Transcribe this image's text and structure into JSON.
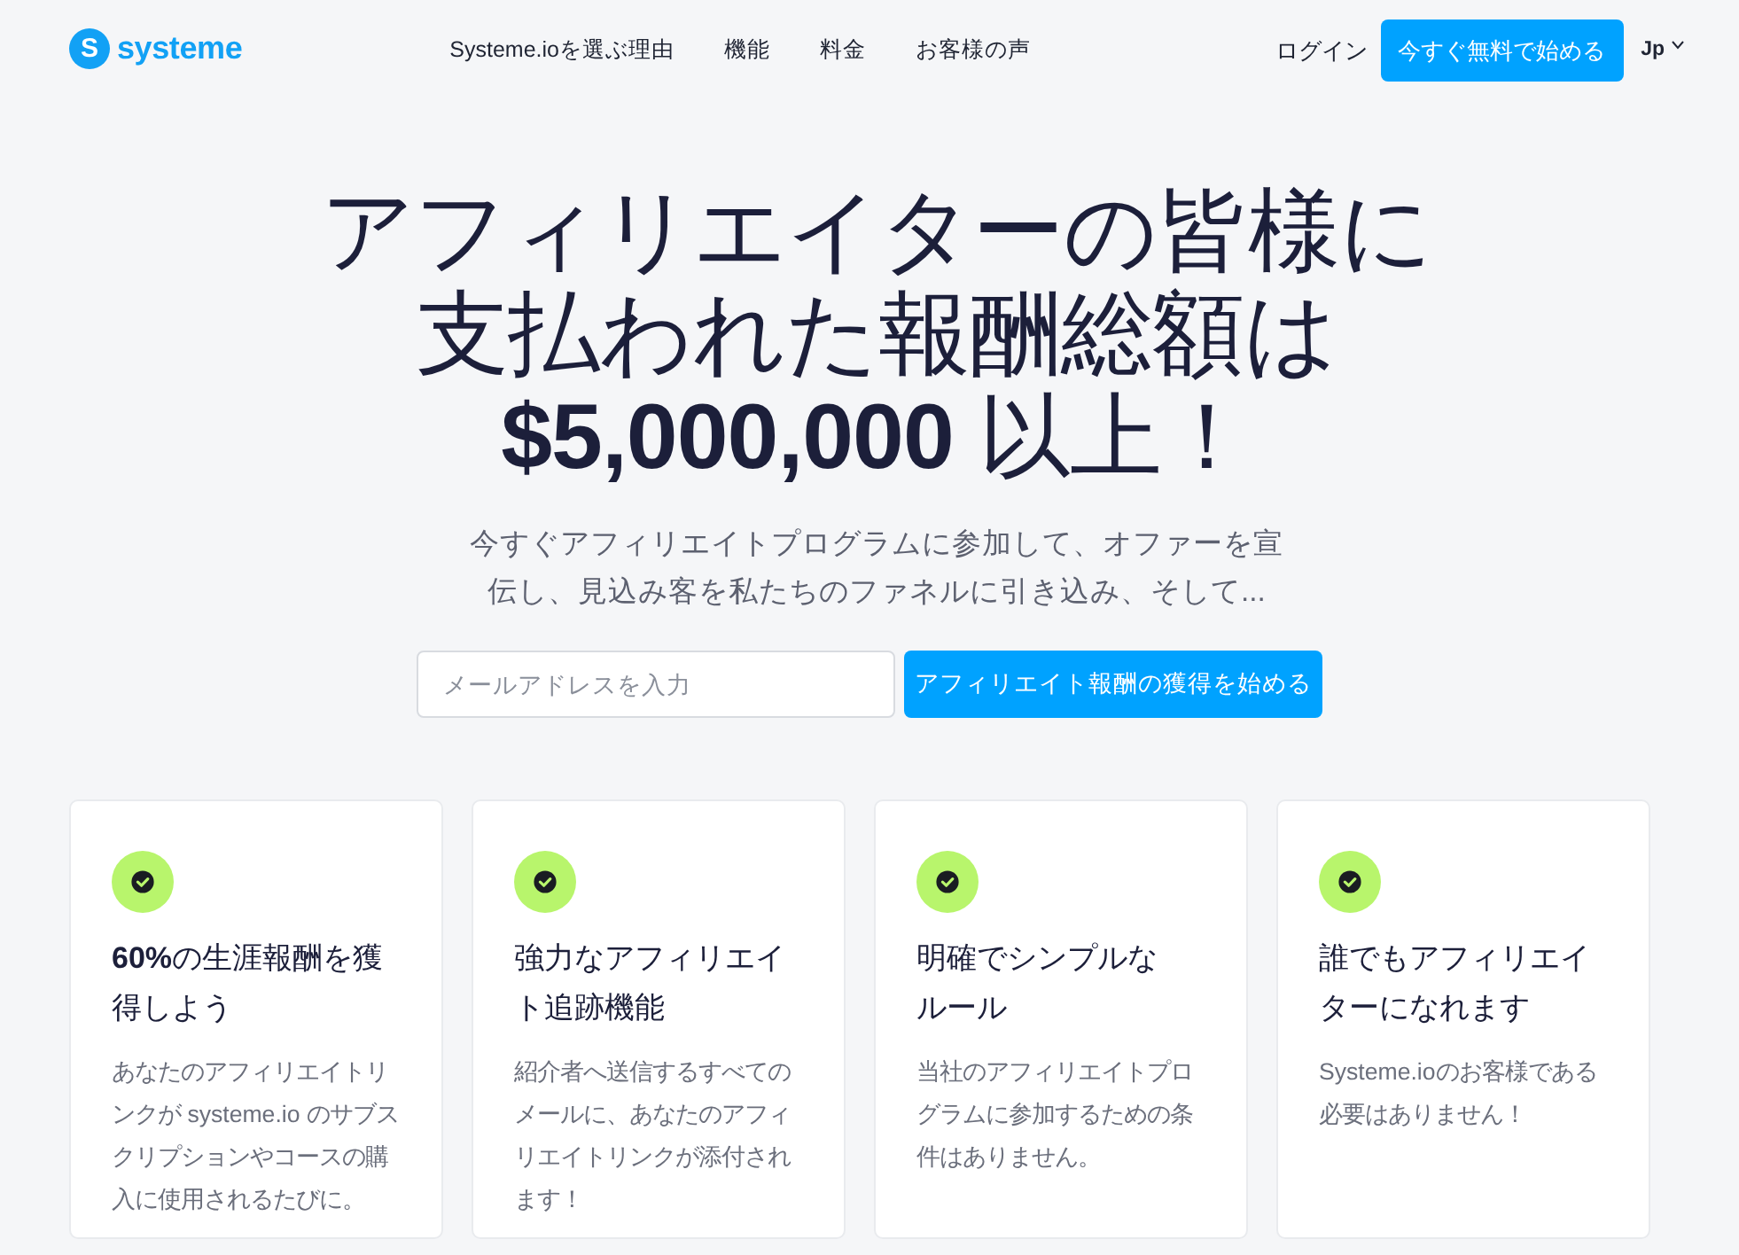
{
  "nav": {
    "logo": {
      "letter": "S",
      "text": "systeme"
    },
    "links": [
      {
        "label": "Systeme.ioを選ぶ理由"
      },
      {
        "label": "機能"
      },
      {
        "label": "料金"
      },
      {
        "label": "お客様の声"
      }
    ],
    "login": "ログイン",
    "cta": "今すぐ無料で始める",
    "language": "Jp"
  },
  "hero": {
    "headline": "アフィリエイターの皆様に支払われた報酬総額は**$5,000,000** 以上！",
    "subtitle": "今すぐアフィリエイトプログラムに参加して、オファーを宣伝し、見込み客を私たちのファネルに引き込み、そして...",
    "email": {
      "placeholder": "メールアドレスを入力"
    },
    "submit": "アフィリエイト報酬の獲得を始める"
  },
  "features": [
    {
      "title": "**60%**の生涯報酬を獲得しよう",
      "text": "あなたのアフィリエイトリンクが systeme.io のサブスクリプションやコースの購入に使用されるたびに。"
    },
    {
      "title": "強力なアフィリエイト追跡機能",
      "text": "紹介者へ送信するすべてのメールに、あなたのアフィリエイトリンクが添付されます！"
    },
    {
      "title": "明確でシンプルなルール",
      "text": "当社のアフィリエイトプログラムに参加するための条件はありません。"
    },
    {
      "title": "誰でもアフィリエイターになれます",
      "text": "Systeme.ioのお客様である必要はありません！"
    }
  ]
}
